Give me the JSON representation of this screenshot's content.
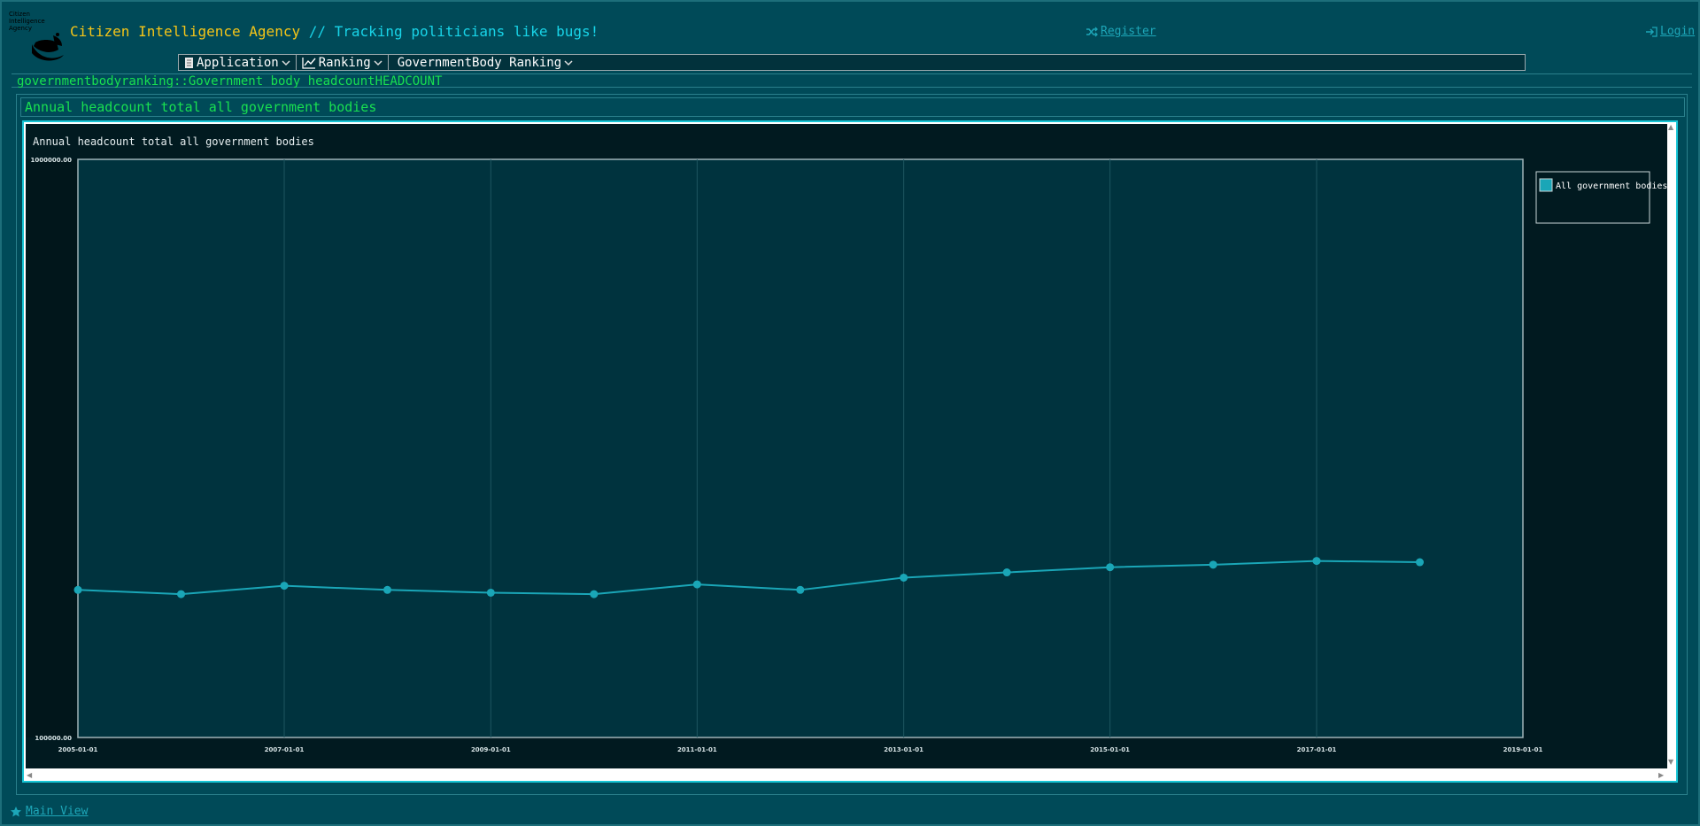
{
  "header": {
    "logo_text": "Citizen Intelligence Agency",
    "brand_name": "Citizen Intelligence Agency",
    "tagline": " // Tracking politicians like bugs!",
    "register_label": "Register",
    "login_label": "Login"
  },
  "menu": {
    "items": [
      {
        "label": "Application",
        "icon": "document-icon"
      },
      {
        "label": "Ranking",
        "icon": "chart-line-icon"
      },
      {
        "label": "GovernmentBody Ranking",
        "icon": ""
      }
    ]
  },
  "page": {
    "title": "governmentbodyranking::Government body headcountHEADCOUNT"
  },
  "panel": {
    "caption": "Annual headcount total all government bodies"
  },
  "footer": {
    "main_view_label": "Main View"
  },
  "colors": {
    "series": "#1aa6b7",
    "accent_green": "#18e050",
    "accent_yellow": "#f5c518",
    "accent_cyan": "#18d4e8"
  },
  "chart_data": {
    "type": "line",
    "title": "Annual headcount total all government bodies",
    "yscale": "log",
    "ylim": [
      100000,
      1000000
    ],
    "ytick_labels": [
      "1000000.00",
      "100000.00"
    ],
    "xlim": [
      "2005-01-01",
      "2019-01-01"
    ],
    "xtick_labels": [
      "2005-01-01",
      "2007-01-01",
      "2009-01-01",
      "2011-01-01",
      "2013-01-01",
      "2015-01-01",
      "2017-01-01",
      "2019-01-01"
    ],
    "grid": true,
    "legend": "top-right",
    "series": [
      {
        "name": "All government bodies",
        "x": [
          "2005-01-01",
          "2006-01-01",
          "2007-01-01",
          "2008-01-01",
          "2009-01-01",
          "2010-01-01",
          "2011-01-01",
          "2012-01-01",
          "2013-01-01",
          "2014-01-01",
          "2015-01-01",
          "2016-01-01",
          "2017-01-01",
          "2018-01-01"
        ],
        "values": [
          180000,
          177000,
          183000,
          180000,
          178000,
          177000,
          184000,
          180000,
          189000,
          193000,
          197000,
          199000,
          202000,
          201000
        ]
      }
    ]
  }
}
